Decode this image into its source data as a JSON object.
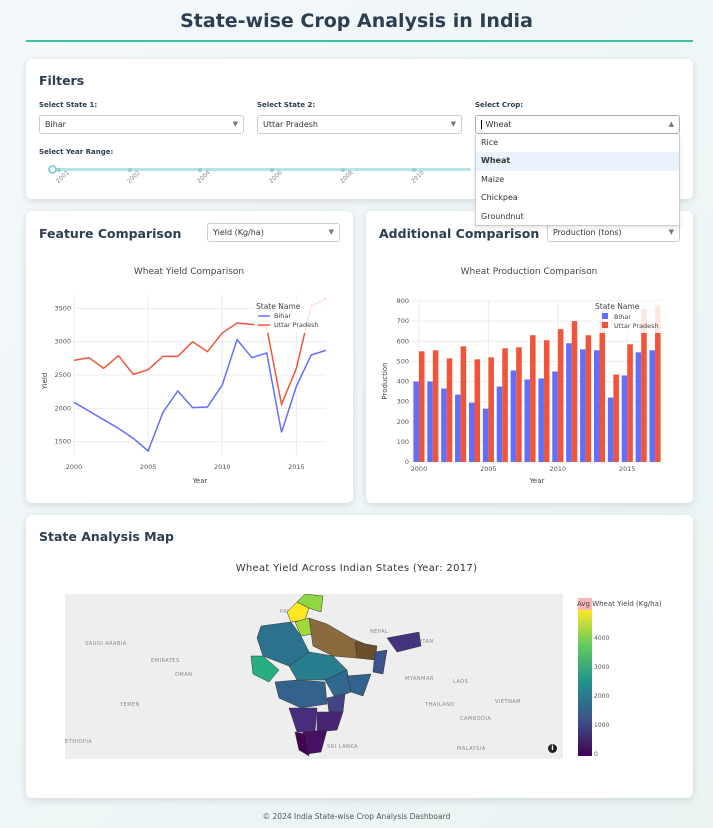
{
  "page": {
    "title": "State-wise Crop Analysis in India",
    "footer": "© 2024 India State-wise Crop Analysis Dashboard"
  },
  "filters": {
    "heading": "Filters",
    "state1_label": "Select State 1:",
    "state1_value": "Bihar",
    "state2_label": "Select State 2:",
    "state2_value": "Uttar Pradesh",
    "crop_label": "Select Crop:",
    "crop_value": "Wheat",
    "crop_options": [
      "Rice",
      "Wheat",
      "Maize",
      "Chickpea",
      "Groundnut"
    ],
    "crop_selected_index": 1,
    "year_label": "Select Year Range:",
    "year_marks": [
      "2001",
      "2002",
      "2004",
      "2006",
      "2008",
      "2010"
    ]
  },
  "feature_comparison": {
    "heading": "Feature Comparison",
    "dropdown_value": "Yield (Kg/ha)"
  },
  "additional_comparison": {
    "heading": "Additional Comparison",
    "dropdown_value": "Production (tons)"
  },
  "map_section": {
    "heading": "State Analysis Map",
    "map_title": "Wheat Yield Across Indian States (Year: 2017)",
    "colorbar_title": "Avg Wheat Yield (Kg/ha)",
    "colorbar_ticks": [
      "4000",
      "3000",
      "2000",
      "1000",
      "0"
    ],
    "geo_labels": [
      "PAKISTAN",
      "SAUDI ARABIA",
      "EMIRATES",
      "OMAN",
      "YEMEN",
      "ETHIOPIA",
      "NEPAL",
      "BHUTAN",
      "MYANMAR",
      "LAOS",
      "THAILAND",
      "CAMBODIA",
      "VIETNAM",
      "SRI LANKA",
      "MALAYSIA"
    ],
    "colors": {
      "low": "#440154",
      "mid": "#21918c",
      "high": "#fde725"
    }
  },
  "colors": {
    "bihar": "#636efa",
    "up": "#ef553b",
    "accent": "#3cc0a0"
  },
  "chart_data": [
    {
      "type": "line",
      "title": "Wheat Yield Comparison",
      "xlabel": "Year",
      "ylabel": "Yield",
      "xlim": [
        2000,
        2017
      ],
      "ylim": [
        1300,
        3700
      ],
      "xticks": [
        2000,
        2005,
        2010,
        2015
      ],
      "yticks": [
        1500,
        2000,
        2500,
        3000,
        3500
      ],
      "legend_title": "State Name",
      "legend_position": "top-right",
      "x": [
        2000,
        2001,
        2002,
        2003,
        2004,
        2005,
        2006,
        2007,
        2008,
        2009,
        2010,
        2011,
        2012,
        2013,
        2014,
        2015,
        2016,
        2017
      ],
      "series": [
        {
          "name": "Bihar",
          "values": [
            2090,
            1960,
            1830,
            1700,
            1550,
            1360,
            1940,
            2260,
            2010,
            2020,
            2350,
            3030,
            2760,
            2830,
            1640,
            2330,
            2800,
            2870
          ]
        },
        {
          "name": "Uttar Pradesh",
          "values": [
            2720,
            2760,
            2600,
            2790,
            2510,
            2580,
            2780,
            2780,
            3000,
            2850,
            3130,
            3280,
            3260,
            3210,
            2060,
            2600,
            3540,
            3640
          ]
        }
      ]
    },
    {
      "type": "bar",
      "title": "Wheat Production Comparison",
      "xlabel": "Year",
      "ylabel": "Production",
      "ylim": [
        0,
        800
      ],
      "xticks": [
        2000,
        2005,
        2010,
        2015
      ],
      "yticks": [
        0,
        100,
        200,
        300,
        400,
        500,
        600,
        700,
        800
      ],
      "legend_title": "State Name",
      "legend_position": "top-right",
      "categories": [
        2000,
        2001,
        2002,
        2003,
        2004,
        2005,
        2006,
        2007,
        2008,
        2009,
        2010,
        2011,
        2012,
        2013,
        2014,
        2015,
        2016,
        2017
      ],
      "series": [
        {
          "name": "Bihar",
          "values": [
            400,
            400,
            365,
            335,
            295,
            265,
            375,
            455,
            410,
            415,
            450,
            590,
            560,
            555,
            320,
            430,
            545,
            555
          ]
        },
        {
          "name": "Uttar Pradesh",
          "values": [
            550,
            555,
            515,
            575,
            510,
            520,
            565,
            570,
            630,
            605,
            660,
            700,
            630,
            700,
            435,
            585,
            760,
            775
          ]
        }
      ]
    }
  ]
}
